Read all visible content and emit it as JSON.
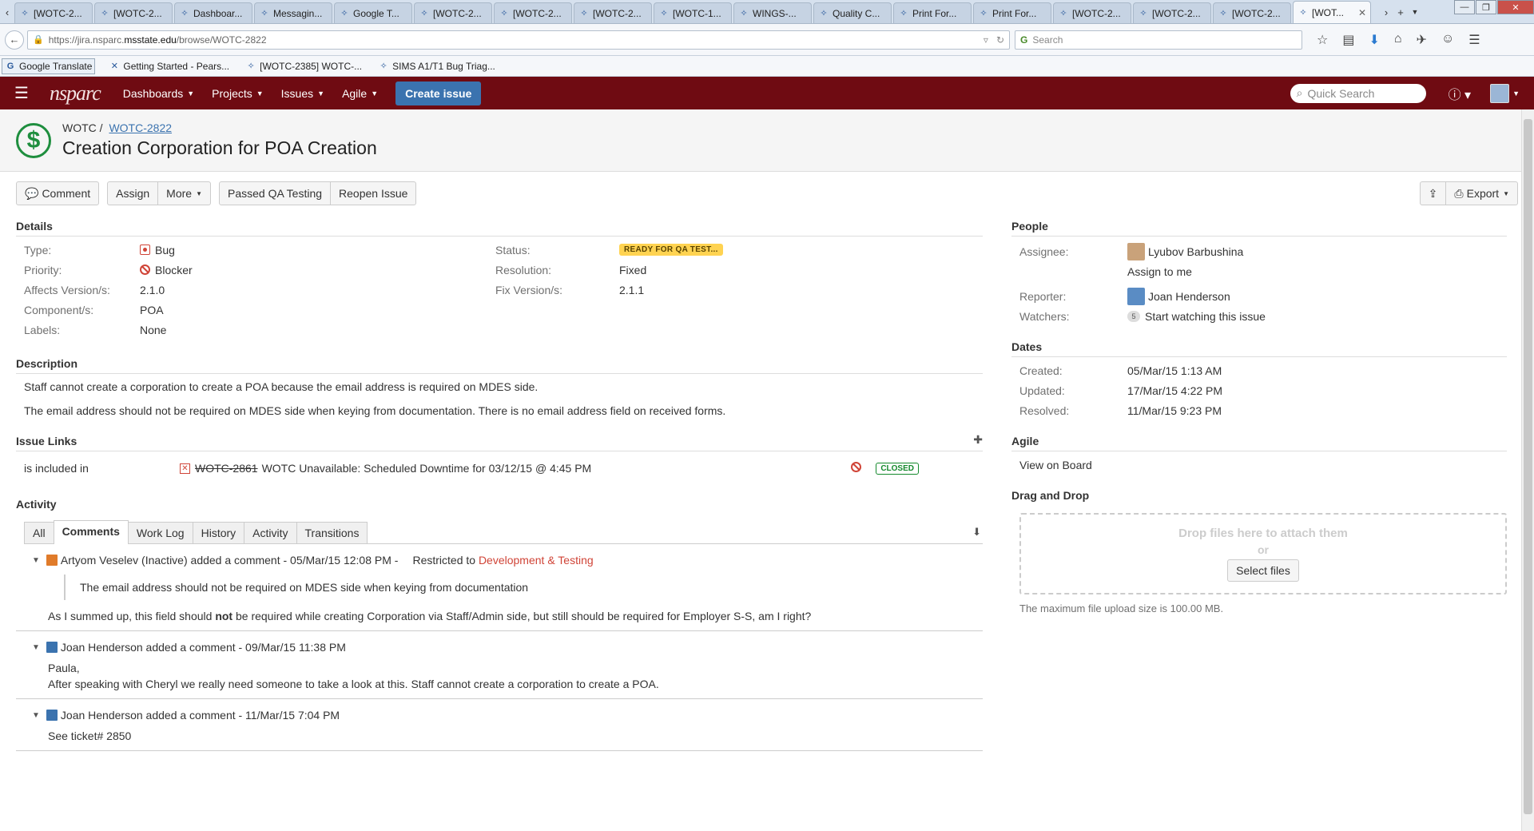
{
  "browser": {
    "tabs": [
      "[WOTC-2...",
      "[WOTC-2...",
      "Dashboar...",
      "Messagin...",
      "Google T...",
      "[WOTC-2...",
      "[WOTC-2...",
      "[WOTC-2...",
      "[WOTC-1...",
      "WINGS-...",
      "Quality C...",
      "Print For...",
      "Print For...",
      "[WOTC-2...",
      "[WOTC-2...",
      "[WOTC-2...",
      "[WOT..."
    ],
    "url_prefix": "https://jira.nsparc.",
    "url_domain": "msstate.edu",
    "url_path": "/browse/WOTC-2822",
    "search_placeholder": "Search",
    "bookmarks": [
      "Google Translate",
      "Getting Started - Pears...",
      "[WOTC-2385] WOTC-...",
      "SIMS A1/T1 Bug Triag..."
    ]
  },
  "header": {
    "logo": "nsparc",
    "nav": [
      "Dashboards",
      "Projects",
      "Issues",
      "Agile"
    ],
    "create_label": "Create issue",
    "quick_search": "Quick Search"
  },
  "issue": {
    "project": "WOTC",
    "key": "WOTC-2822",
    "title": "Creation Corporation for POA Creation"
  },
  "toolbar": {
    "comment": "Comment",
    "assign": "Assign",
    "more": "More",
    "passed_qa": "Passed QA Testing",
    "reopen": "Reopen Issue",
    "export": "Export"
  },
  "details": {
    "heading": "Details",
    "type_label": "Type:",
    "type": "Bug",
    "priority_label": "Priority:",
    "priority": "Blocker",
    "affects_label": "Affects Version/s:",
    "affects": "2.1.0",
    "component_label": "Component/s:",
    "component": "POA",
    "labels_label": "Labels:",
    "labels": "None",
    "status_label": "Status:",
    "status": "READY FOR QA TEST...",
    "resolution_label": "Resolution:",
    "resolution": "Fixed",
    "fix_label": "Fix Version/s:",
    "fix": "2.1.1"
  },
  "description": {
    "heading": "Description",
    "p1": "Staff cannot create a corporation to create a POA because the email address is required on MDES side.",
    "p2": "The email address should not be required on MDES side when keying from documentation. There is no email address field on received forms."
  },
  "links": {
    "heading": "Issue Links",
    "relation": "is included in",
    "key": "WOTC-2861",
    "summary": "WOTC Unavailable: Scheduled Downtime for 03/12/15 @ 4:45 PM",
    "status": "CLOSED"
  },
  "activity": {
    "heading": "Activity",
    "tabs": [
      "All",
      "Comments",
      "Work Log",
      "History",
      "Activity",
      "Transitions"
    ],
    "comments": [
      {
        "author": "Artyom Veselev (Inactive)",
        "meta": "added a comment - 05/Mar/15 12:08 PM -",
        "restricted_prefix": "Restricted to",
        "restricted_group": "Development & Testing",
        "quote": "The email address should not be required on MDES side when keying from documentation",
        "body_pre": "As I summed up, this field should ",
        "body_bold": "not",
        "body_post": " be required while creating Corporation via Staff/Admin side, but still should be required for Employer S-S, am I right?"
      },
      {
        "author": "Joan Henderson",
        "meta": "added a comment - 09/Mar/15 11:38 PM",
        "line1": "Paula,",
        "line2": "After speaking with Cheryl we really need someone to take a look at this. Staff cannot create a corporation to create a POA."
      },
      {
        "author": "Joan Henderson",
        "meta": "added a comment - 11/Mar/15 7:04 PM",
        "line1": "See ticket# 2850"
      }
    ]
  },
  "people": {
    "heading": "People",
    "assignee_label": "Assignee:",
    "assignee": "Lyubov Barbushina",
    "assign_to_me": "Assign to me",
    "reporter_label": "Reporter:",
    "reporter": "Joan Henderson",
    "watchers_label": "Watchers:",
    "watchers_count": "5",
    "watch_link": "Start watching this issue"
  },
  "dates": {
    "heading": "Dates",
    "created_label": "Created:",
    "created": "05/Mar/15 1:13 AM",
    "updated_label": "Updated:",
    "updated": "17/Mar/15 4:22 PM",
    "resolved_label": "Resolved:",
    "resolved": "11/Mar/15 9:23 PM"
  },
  "agile": {
    "heading": "Agile",
    "view_on_board": "View on Board"
  },
  "dragdrop": {
    "heading": "Drag and Drop",
    "drop_text": "Drop files here to attach them",
    "or": "or",
    "select": "Select files",
    "max_size": "The maximum file upload size is 100.00 MB."
  }
}
